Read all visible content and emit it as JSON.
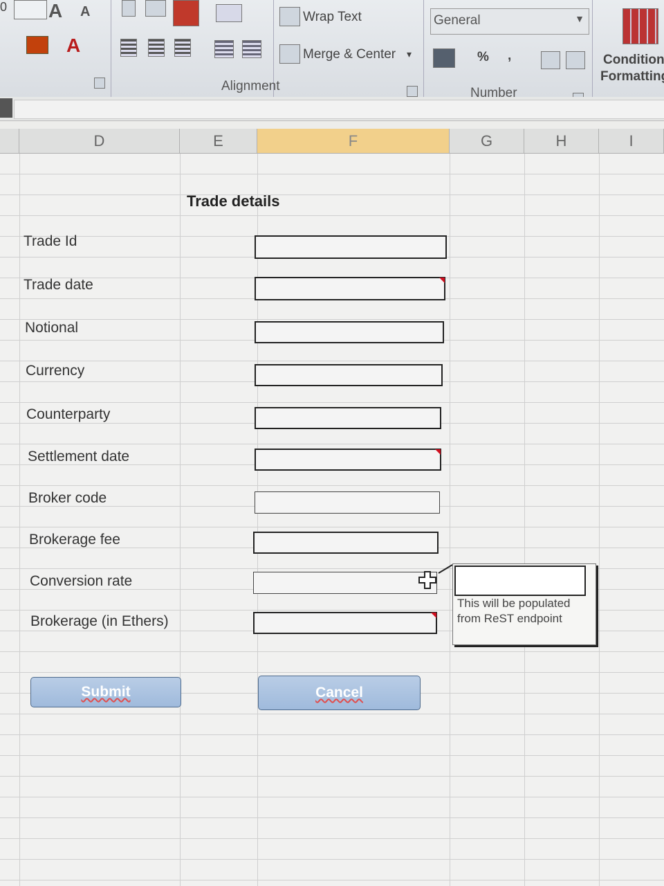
{
  "ribbon": {
    "font_grow": "A",
    "font_shrink": "A",
    "font_color_label": "A",
    "wrap_text": "Wrap Text",
    "merge_center": "Merge & Center",
    "merge_dropdown": "▾",
    "alignment_group": "Alignment",
    "number_format": "General",
    "percent": "%",
    "comma": ",",
    "number_group": "Number",
    "conditional_line1": "Condition",
    "conditional_line2": "Formatting",
    "cell_ref_fragment": "0",
    "icons": [
      "font-grow-icon",
      "font-shrink-icon",
      "fill-color-icon",
      "font-color-icon",
      "align-left-icon",
      "align-center-icon",
      "align-right-icon",
      "decrease-indent-icon",
      "increase-indent-icon",
      "orientation-icon",
      "wrap-text-icon",
      "merge-center-icon",
      "accounting-format-icon",
      "percent-icon",
      "comma-icon",
      "increase-decimal-icon",
      "decrease-decimal-icon",
      "conditional-formatting-icon",
      "dialog-launcher-icon"
    ]
  },
  "columns": [
    "D",
    "E",
    "F",
    "G",
    "H",
    "I"
  ],
  "selected_column": "F",
  "form": {
    "title": "Trade details",
    "fields": [
      {
        "label": "Trade Id"
      },
      {
        "label": "Trade date"
      },
      {
        "label": "Notional"
      },
      {
        "label": "Currency"
      },
      {
        "label": "Counterparty"
      },
      {
        "label": "Settlement date"
      },
      {
        "label": "Broker code"
      },
      {
        "label": "Brokerage fee"
      },
      {
        "label": "Conversion rate"
      },
      {
        "label": "Brokerage (in Ethers)"
      }
    ],
    "submit_label": "Submit",
    "cancel_label": "Cancel"
  },
  "comment": {
    "text": "This will be populated\nfrom ReST endpoint"
  },
  "colors": {
    "selected_header": "#f2d08b",
    "comment_indicator": "#d01020",
    "button": "#a9c3e3"
  }
}
